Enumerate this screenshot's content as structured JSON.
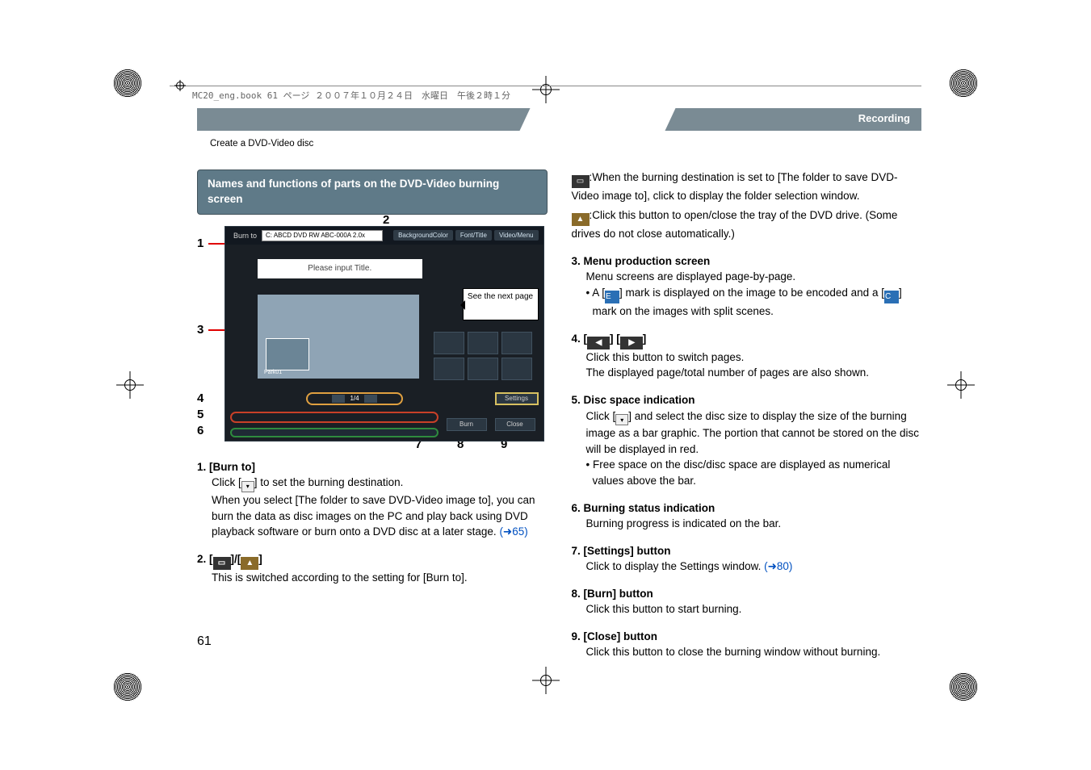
{
  "header_filename": "MC20_eng.book  61 ページ  ２００７年１０月２４日　水曜日　午後２時１分",
  "banner": "Recording",
  "breadcrumb": "Create a DVD-Video disc",
  "subsection_title": "Names and functions of parts on the DVD-Video burning screen",
  "shot": {
    "burn_to_label": "Burn to",
    "burn_to_value": "C: ABCD DVD RW ABC-000A 2.0x",
    "tab1": "BackgroundColor",
    "tab2": "Font/Title",
    "tab3": "Video/Menu",
    "title_placeholder": "Please input Title.",
    "next_page": "See the next page",
    "thumb_label": "Park01",
    "pager_text": "1/4",
    "settings_btn": "Settings",
    "burn_btn": "Burn",
    "close_btn": "Close"
  },
  "callouts": {
    "c1": "1",
    "c2": "2",
    "c3": "3",
    "c4": "4",
    "c5": "5",
    "c6": "6",
    "c7": "7",
    "c8": "8",
    "c9": "9"
  },
  "left": {
    "i1_head": "1. [Burn to]",
    "i1_l1": "Click [",
    "i1_l1b": "] to set the burning destination.",
    "i1_l2": "When you select [The folder to save DVD-Video image to], you can burn the data as disc images on the PC and play back using DVD playback software or burn onto a DVD disc at a later stage. ",
    "i1_link": "(➜65)",
    "i2_head": "2. [",
    "i2_mid": "]/[",
    "i2_end": "]",
    "i2_body": "This is switched according to the setting for [Burn to]."
  },
  "right": {
    "r_folder": ":When the burning destination is set to [The folder to save DVD-Video image to], click to display the folder selection window.",
    "r_eject": ":Click this button to open/close the tray of the DVD drive. (Some drives do not close automatically.)",
    "i3_head": "3. Menu production screen",
    "i3_l1": "Menu screens are displayed page-by-page.",
    "i3_b1a": "A [",
    "i3_b1b": "] mark is displayed on the image to be encoded and a [",
    "i3_b1c": "] mark on the images with split scenes.",
    "i4_head": "4. [",
    "i4_mid": "] [",
    "i4_end": "]",
    "i4_l1": "Click this button to switch pages.",
    "i4_l2": "The displayed page/total number of pages are also shown.",
    "i5_head": "5. Disc space indication",
    "i5_l1a": "Click [",
    "i5_l1b": "] and select the disc size to display the size of the burning image as a bar graphic. The portion that cannot be stored on the disc will be displayed in red.",
    "i5_b1": "Free space on the disc/disc space are displayed as numerical values above the bar.",
    "i6_head": "6. Burning status indication",
    "i6_l1": "Burning progress is indicated on the bar.",
    "i7_head": "7. [Settings] button",
    "i7_l1": "Click to display the Settings window. ",
    "i7_link": "(➜80)",
    "i8_head": "8. [Burn] button",
    "i8_l1": "Click this button to start burning.",
    "i9_head": "9. [Close] button",
    "i9_l1": "Click this button to close the burning window without burning."
  },
  "page_number": "61"
}
